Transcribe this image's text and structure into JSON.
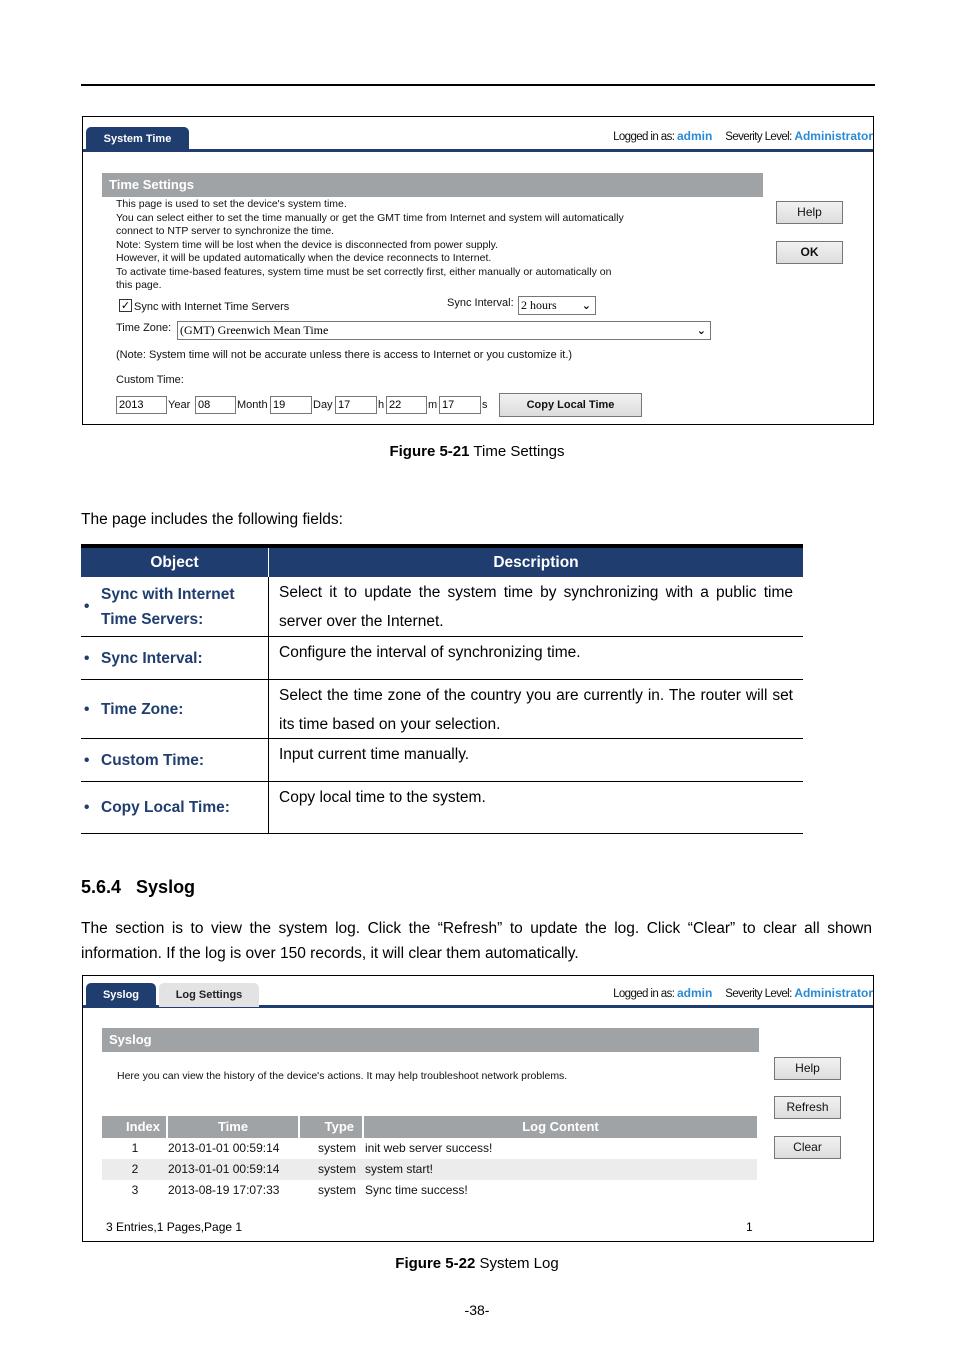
{
  "figure1": {
    "tabs": [
      {
        "label": "System Time",
        "active": true
      }
    ],
    "login": {
      "logged_label": "Logged in as:",
      "user": "admin",
      "severity_label": "Severity Level:",
      "severity": "Administrator"
    },
    "section_title": "Time Settings",
    "intro_lines": [
      "This page is used to set the device's system time.",
      "You can select either to set the time manually or get the GMT time from Internet and system will automatically",
      "connect to NTP server to synchronize the time.",
      "Note: System time will be lost when the device is disconnected from power supply.",
      "However, it will be updated automatically when the device reconnects to Internet.",
      "To activate time-based features, system time must be set correctly first, either manually or automatically on",
      "this page."
    ],
    "sync_checkbox": {
      "label": "Sync with Internet Time Servers",
      "checked": true
    },
    "sync_interval": {
      "label": "Sync Interval:",
      "value": "2 hours"
    },
    "time_zone": {
      "label": "Time Zone:",
      "value": "(GMT) Greenwich Mean Time"
    },
    "note": "(Note: System time will not be accurate unless there is access to Internet or you customize it.)",
    "custom_time": {
      "label": "Custom Time:",
      "year": "2013",
      "year_label": "Year",
      "month": "08",
      "month_label": "Month",
      "day": "19",
      "day_label": "Day",
      "hour": "17",
      "hour_label": "h",
      "minute": "22",
      "minute_label": "m",
      "second": "17",
      "second_label": "s"
    },
    "buttons": {
      "copy_local": "Copy Local Time",
      "help": "Help",
      "ok": "OK"
    },
    "caption_bold": "Figure 5-21",
    "caption_text": " Time Settings"
  },
  "fields_intro": "The page includes the following fields:",
  "fields_table": {
    "headers": [
      "Object",
      "Description"
    ],
    "rows": [
      {
        "object": "Sync with Internet Time Servers:",
        "description": "Select it to update the system time by synchronizing with a public time server over the Internet."
      },
      {
        "object": "Sync Interval:",
        "description": "Configure the interval of synchronizing time."
      },
      {
        "object": "Time Zone:",
        "description": "Select the time zone of the country you are currently in. The router will set its time based on your selection."
      },
      {
        "object": "Custom Time:",
        "description": "Input current time manually."
      },
      {
        "object": "Copy Local Time:",
        "description": "Copy local time to the system."
      }
    ]
  },
  "section": {
    "heading": "5.6.4   Syslog",
    "paragraph": "The section is to view the system log. Click the “Refresh” to update the log. Click “Clear” to clear all shown information. If the log is over 150 records, it will clear them automatically."
  },
  "figure2": {
    "tabs": [
      {
        "label": "Syslog",
        "active": true
      },
      {
        "label": "Log Settings",
        "active": false
      }
    ],
    "login": {
      "logged_label": "Logged in as:",
      "user": "admin",
      "severity_label": "Severity Level:",
      "severity": "Administrator"
    },
    "section_title": "Syslog",
    "intro": "Here you can view the history of the device's actions. It may help troubleshoot network problems.",
    "table_headers": [
      "Index",
      "Time",
      "Type",
      "Log Content"
    ],
    "rows": [
      {
        "index": "1",
        "time": "2013-01-01 00:59:14",
        "type": "system",
        "content": "init web server success!"
      },
      {
        "index": "2",
        "time": "2013-01-01 00:59:14",
        "type": "system",
        "content": "system start!"
      },
      {
        "index": "3",
        "time": "2013-08-19 17:07:33",
        "type": "system",
        "content": "Sync time success!"
      }
    ],
    "footer_summary": "3 Entries,1 Pages,Page 1",
    "page_link": "1",
    "buttons": {
      "help": "Help",
      "refresh": "Refresh",
      "clear": "Clear"
    },
    "caption_bold": "Figure 5-22",
    "caption_text": " System Log"
  },
  "page_number": "-38-"
}
